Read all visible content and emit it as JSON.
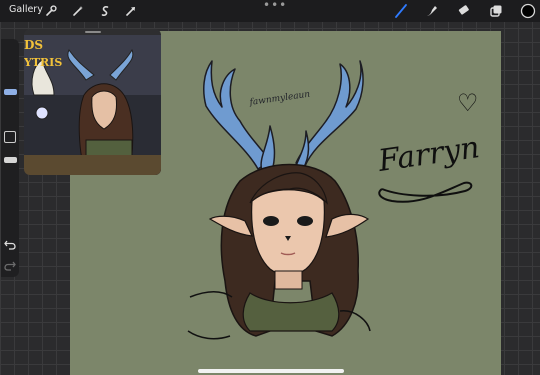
{
  "topbar": {
    "gallery_label": "Gallery",
    "more_dots": "•••"
  },
  "reference": {
    "title_line1": "DS",
    "title_line2": "YTRIS"
  },
  "artwork": {
    "name_text": "Farryn",
    "heart": "♡",
    "signature": "fawnmyleaun"
  },
  "colors": {
    "canvas": "#7c866a",
    "accent_blue": "#2f7bff",
    "toolbar": "#1c1c1e"
  }
}
